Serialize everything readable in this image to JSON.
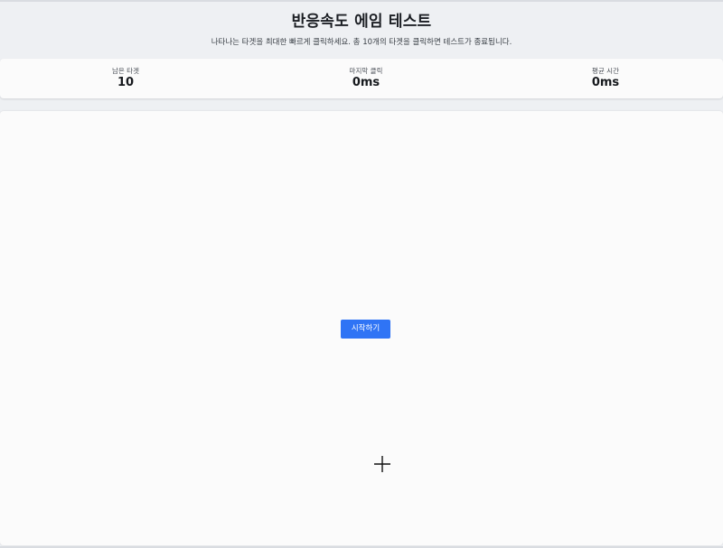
{
  "header": {
    "title": "반응속도 에임 테스트",
    "subtitle": "나타나는 타겟을 최대한 빠르게 클릭하세요. 총 10개의 타겟을 클릭하면 테스트가 종료됩니다."
  },
  "stats": {
    "remaining_label": "남은 타겟",
    "remaining_value": "10",
    "last_label": "마지막 클릭",
    "last_value": "0ms",
    "avg_label": "평균 시간",
    "avg_value": "0ms"
  },
  "arena": {
    "start_label": "시작하기",
    "cursor_icon": "crosshair-icon"
  },
  "colors": {
    "accent": "#2f74f5",
    "background": "#eef0f3",
    "panel": "#fbfbfb"
  }
}
